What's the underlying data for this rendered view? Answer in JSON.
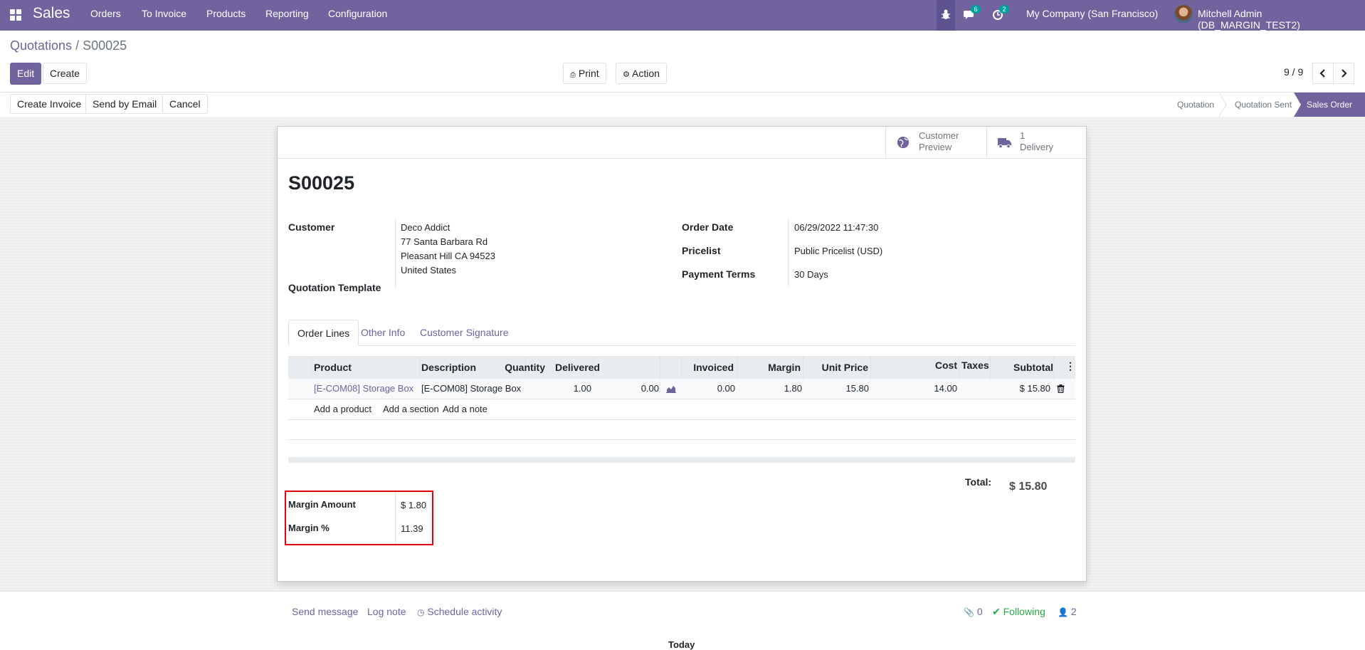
{
  "navbar": {
    "app_name": "Sales",
    "menu": [
      "Orders",
      "To Invoice",
      "Products",
      "Reporting",
      "Configuration"
    ],
    "messages_count": "6",
    "activities_count": "2",
    "company": "My Company (San Francisco)",
    "user": "Mitchell Admin (DB_MARGIN_TEST2)"
  },
  "breadcrumb": {
    "parent": "Quotations",
    "separator": "/",
    "current": "S00025"
  },
  "toolbar": {
    "edit": "Edit",
    "create": "Create",
    "print": "Print",
    "action": "Action",
    "pager": "9 / 9"
  },
  "statusbar": {
    "buttons": [
      "Create Invoice",
      "Send by Email",
      "Cancel"
    ],
    "stages": [
      "Quotation",
      "Quotation Sent",
      "Sales Order"
    ],
    "active_stage": "Sales Order"
  },
  "smart_buttons": {
    "preview_line1": "Customer",
    "preview_line2": "Preview",
    "delivery_line1": "1",
    "delivery_line2": "Delivery"
  },
  "order": {
    "name": "S00025",
    "customer_label": "Customer",
    "customer_name": "Deco Addict",
    "address1": "77 Santa Barbara Rd",
    "address2": "Pleasant Hill CA 94523",
    "address3": "United States",
    "template_label": "Quotation Template",
    "order_date_label": "Order Date",
    "order_date": "06/29/2022 11:47:30",
    "pricelist_label": "Pricelist",
    "pricelist": "Public Pricelist (USD)",
    "payment_terms_label": "Payment Terms",
    "payment_terms": "30 Days"
  },
  "tabs": [
    "Order Lines",
    "Other Info",
    "Customer Signature"
  ],
  "lines": {
    "headers": [
      "Product",
      "Description",
      "Quantity",
      "Delivered",
      "Invoiced",
      "Margin",
      "Unit Price",
      "Cost",
      "Taxes",
      "Subtotal"
    ],
    "row": {
      "product": "[E-COM08] Storage Box",
      "description": "[E-COM08] Storage Box",
      "quantity": "1.00",
      "delivered": "0.00",
      "invoiced": "0.00",
      "margin": "1.80",
      "unit_price": "15.80",
      "cost": "14.00",
      "taxes": "",
      "subtotal": "$ 15.80"
    },
    "add_product": "Add a product",
    "add_section": "Add a section",
    "add_note": "Add a note"
  },
  "totals": {
    "total_label": "Total:",
    "total_value": "$ 15.80",
    "margin_amount_label": "Margin Amount",
    "margin_amount": "$ 1.80",
    "margin_pct_label": "Margin %",
    "margin_pct": "11.39"
  },
  "chatter": {
    "send_message": "Send message",
    "log_note": "Log note",
    "schedule_activity": "Schedule activity",
    "attachments": "0",
    "following": "Following",
    "followers": "2",
    "today": "Today"
  },
  "colors": {
    "brand": "#71639e",
    "highlight_border": "#e3000f",
    "following": "#28a745"
  }
}
